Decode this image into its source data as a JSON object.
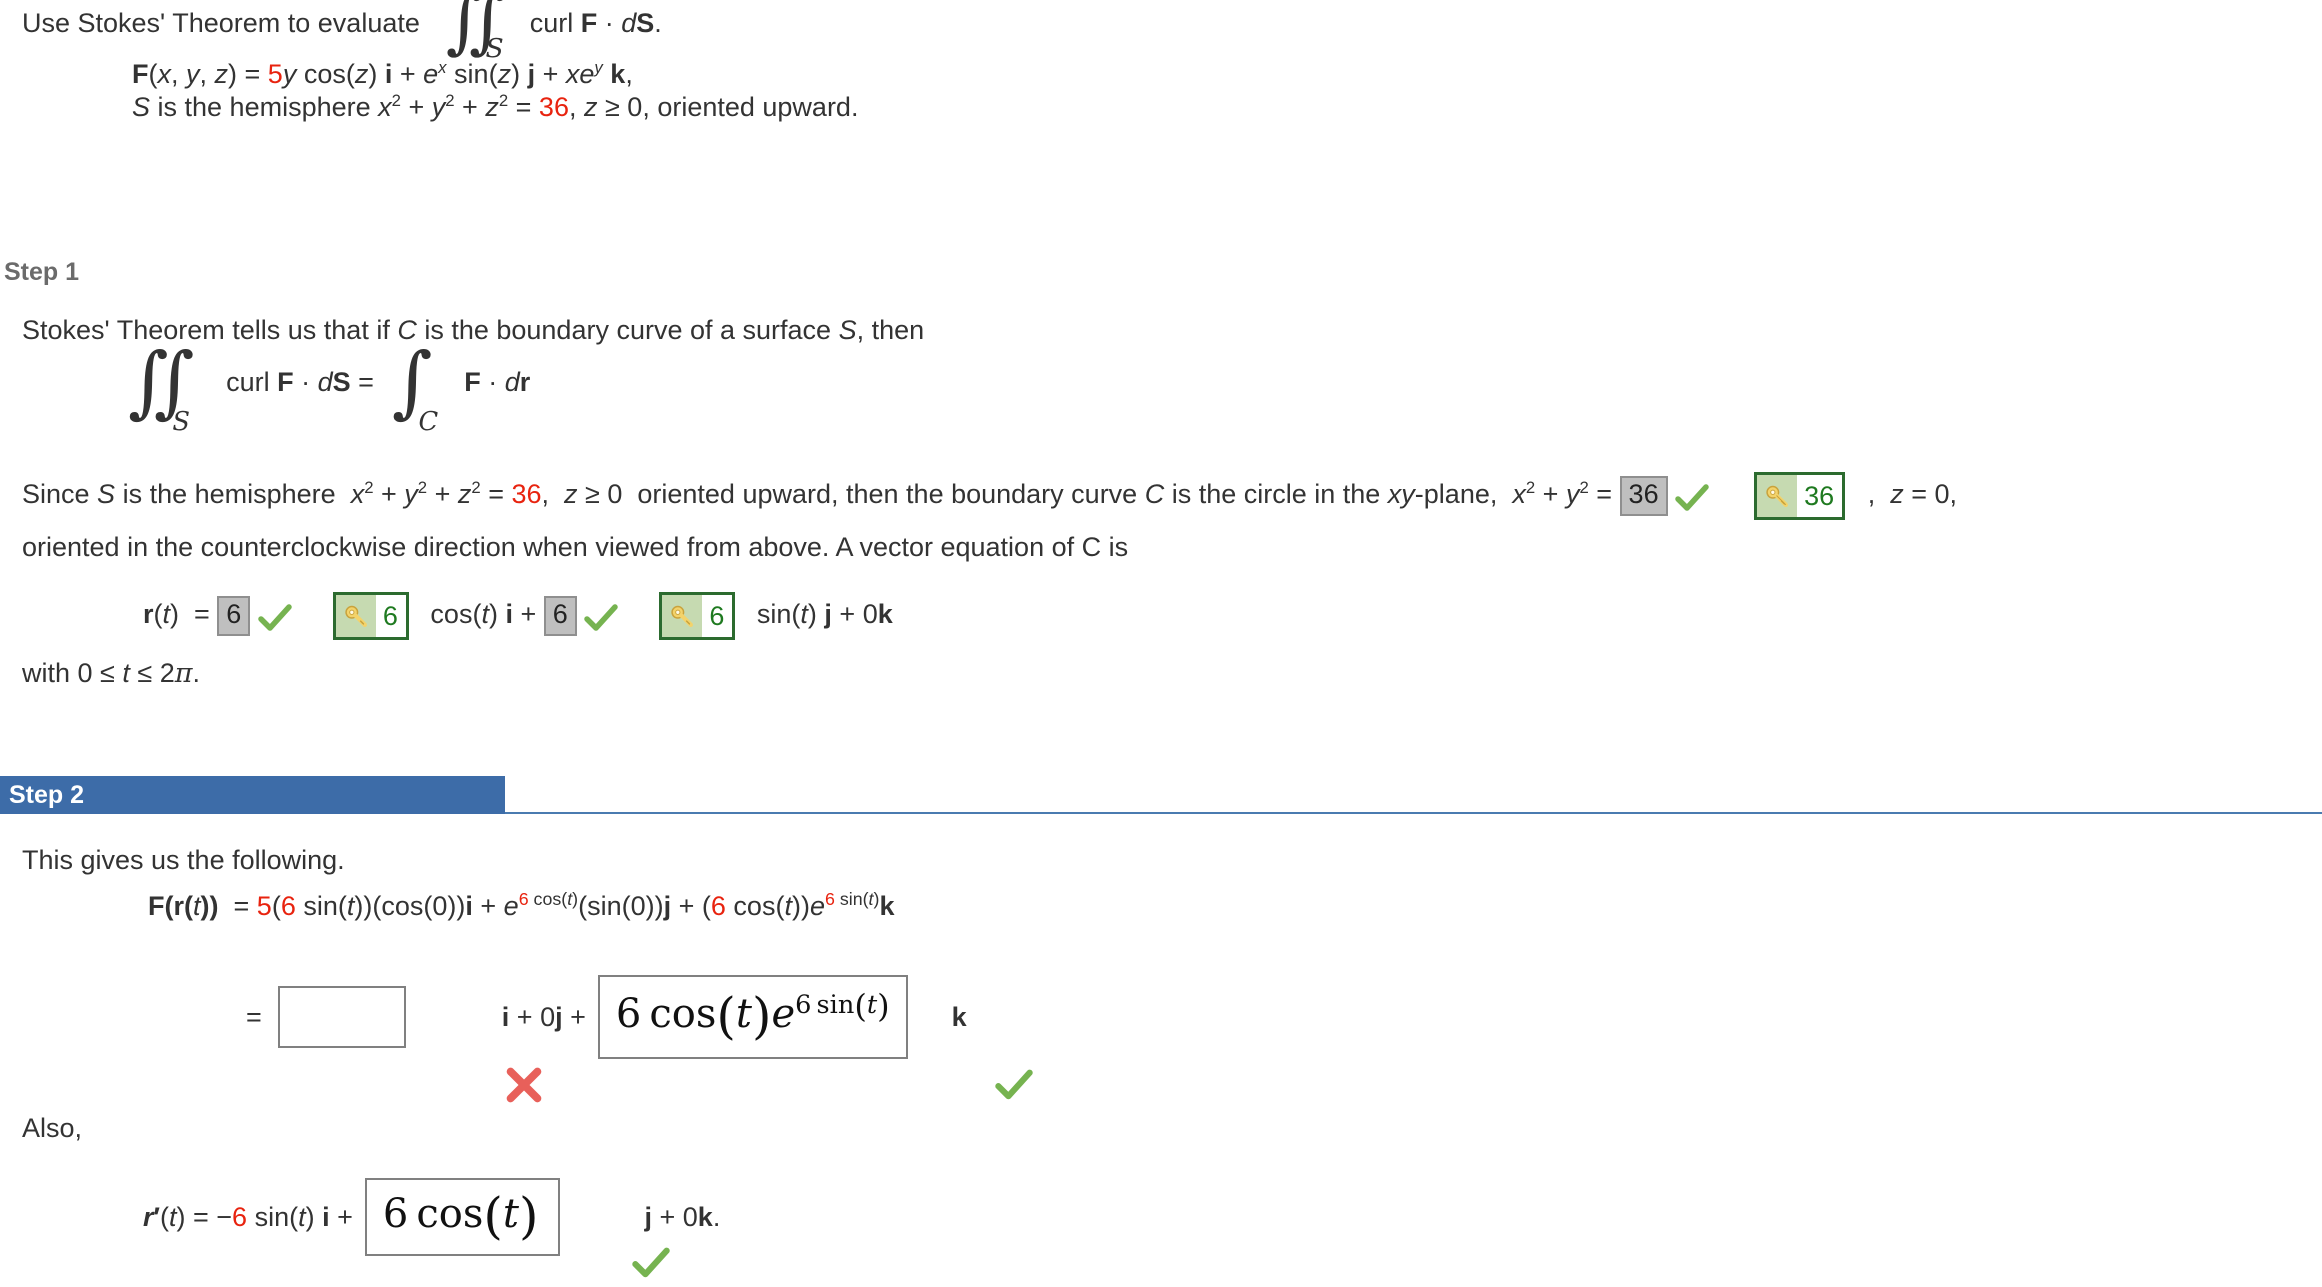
{
  "problem": {
    "prompt": "Use Stokes' Theorem to evaluate",
    "integral_symbol": "∬",
    "integral_subscript": "S",
    "integrand": "curl F · dS.",
    "field_line": "F(x, y, z) =  5y cos(z) i + e",
    "field_exp_x": "x",
    "field_mid": " sin(z) j + xe",
    "field_exp_y": "y",
    "field_end": " k,",
    "field_coefficient": "5",
    "surface_line_prefix": "S is the hemisphere x",
    "surface_value": "36",
    "surface_line_suffix": ", z ≥ 0, oriented upward."
  },
  "step1": {
    "label": "Step 1",
    "intro": "Stokes' Theorem tells us that if C is the boundary curve of a surface S, then",
    "equation": {
      "lhs_integral": "∬",
      "lhs_sub": "S",
      "lhs_body": "curl F · dS =",
      "rhs_integral": "∫",
      "rhs_sub": "C",
      "rhs_body": "F · dr"
    },
    "since_part1": "Since S is the hemisphere",
    "since_eq": "x² + y² + z² =",
    "since_radius": "36",
    "since_part2": ", z ≥ 0  oriented upward, then the boundary curve C is the circle in the xy-plane,",
    "since_circle_eq": "x² + y² =",
    "answer_radius_squared": "36",
    "key_radius_squared": "36",
    "since_tail": ", z = 0,",
    "orientation_text": "oriented in the counterclockwise direction when viewed from above. A vector equation of C is",
    "rt": {
      "label": "r(t)  =",
      "a1": "6",
      "key_a1": "6",
      "mid1": "cos(t) i +",
      "a2": "6",
      "key_a2": "6",
      "mid2": "sin(t) j + 0k"
    },
    "domain": "with 0 ≤ t ≤ 2π."
  },
  "step2": {
    "label": "Step 2",
    "intro": "This gives us the following.",
    "frt": {
      "lhs": "F(r(t))  =",
      "c1": "5",
      "t1": "(",
      "c2": "6",
      "t2": " sin(t))(cos(0))i + e",
      "exp1_c": "6",
      "exp1_t": " cos(t)",
      "t3": "(sin(0))j + (",
      "c3": "6",
      "t4": " cos(t))e",
      "exp2_c": "6",
      "exp2_t": " sin(t)",
      "t5": "k"
    },
    "eq2": {
      "equals": "=",
      "blank_value": "",
      "mid": "i + 0j +",
      "box_math": "6 cos(t)e^{6 sin(t)}",
      "box_base": "6 cos",
      "box_var": "t",
      "box_exp_num": "6 sin",
      "box_exp_var": "t",
      "trailing": "k"
    },
    "also": "Also,",
    "rprime": {
      "lhs": "r′(t)  =  −",
      "coefficient": "6",
      "mid": " sin(t) i +",
      "box_base": "6 cos",
      "box_var": "t",
      "tail": "j + 0k."
    }
  },
  "colors": {
    "accent_blue": "#3d6ca8",
    "red": "#e8230f",
    "check_green": "#76b350",
    "cross_red": "#e8605a",
    "key_border": "#2c6b2f",
    "key_fill": "#c6dab1",
    "gray_box": "#bfbfbf"
  }
}
